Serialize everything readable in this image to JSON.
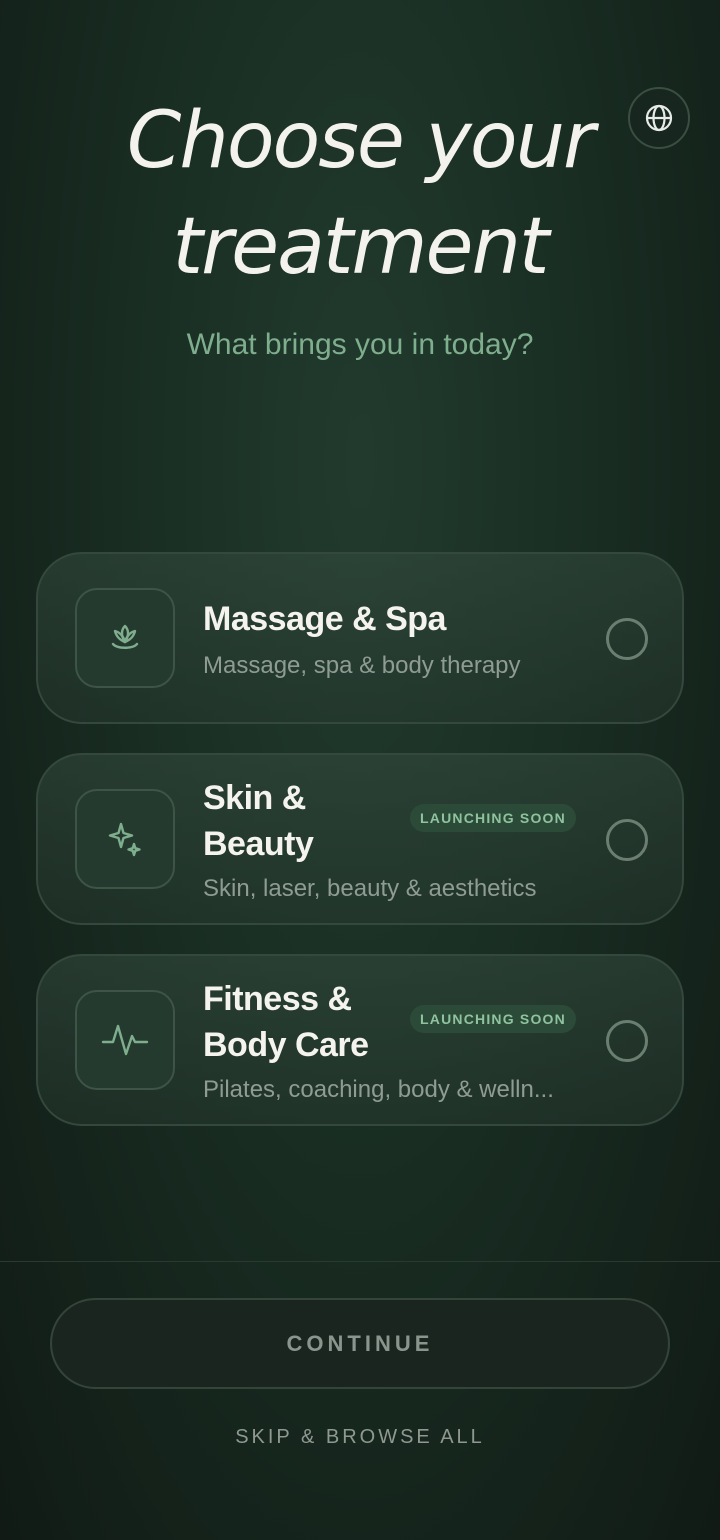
{
  "header": {
    "title_line1": "Choose your",
    "title_line2": "treatment",
    "subtitle": "What brings you in today?"
  },
  "language_button": {
    "icon": "globe-icon"
  },
  "options": [
    {
      "title_line1": "Massage & Spa",
      "title_line2": "",
      "description": "Massage, spa & body therapy",
      "icon": "lotus-icon",
      "badge": "",
      "selected": false
    },
    {
      "title_line1": "Skin &",
      "title_line2": "Beauty",
      "description": "Skin, laser, beauty & aesthetics",
      "icon": "sparkle-icon",
      "badge": "LAUNCHING SOON",
      "selected": false
    },
    {
      "title_line1": "Fitness &",
      "title_line2": "Body Care",
      "description": "Pilates, coaching, body & welln...",
      "icon": "pulse-icon",
      "badge": "LAUNCHING SOON",
      "selected": false
    }
  ],
  "footer": {
    "continue_label": "CONTINUE",
    "skip_label": "SKIP & BROWSE ALL"
  },
  "colors": {
    "accent": "#7fae8e",
    "background": "#1a2f24",
    "badge_bg": "#2c4a38"
  }
}
